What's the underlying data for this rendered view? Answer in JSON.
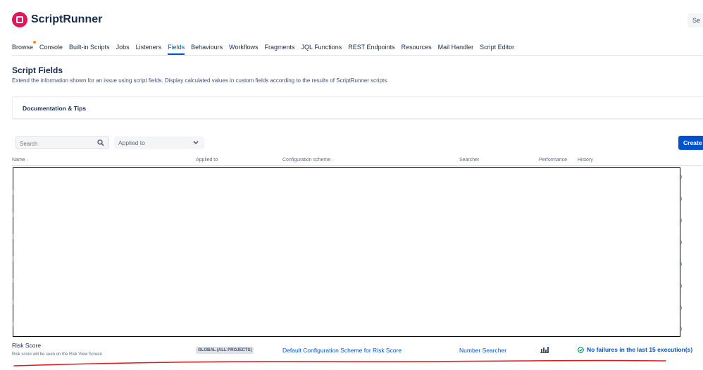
{
  "header": {
    "brand": "ScriptRunner",
    "right_button": "Se"
  },
  "nav": {
    "items": [
      "Browse",
      "Console",
      "Built-in Scripts",
      "Jobs",
      "Listeners",
      "Fields",
      "Behaviours",
      "Workflows",
      "Fragments",
      "JQL Functions",
      "REST Endpoints",
      "Resources",
      "Mail Handler",
      "Script Editor"
    ],
    "active": "Fields"
  },
  "page": {
    "title": "Script Fields",
    "description": "Extend the information shown for an issue using script fields. Display calculated values in custom fields according to the results of ScriptRunner scripts."
  },
  "docs": {
    "label": "Documentation & Tips"
  },
  "filters": {
    "search_placeholder": "Search",
    "applied_to": "Applied to"
  },
  "create_button": "Create",
  "table": {
    "columns": [
      "Name",
      "Applied to",
      "Configuration scheme",
      "Searcher",
      "Performance",
      "History"
    ],
    "rows": [
      {
        "name": "Risk Score",
        "description": "Risk score will be seen on the Risk View Screen",
        "applied_to": "GLOBAL (ALL PROJECTS)",
        "configuration_scheme": "Default Configuration Scheme for Risk Score",
        "searcher": "Number Searcher",
        "history": "No failures in the last 15 execution(s)"
      }
    ]
  },
  "colors": {
    "brand": "#e2175a",
    "link": "#0052cc",
    "annotation": "#e8141a",
    "success": "#00875a"
  }
}
